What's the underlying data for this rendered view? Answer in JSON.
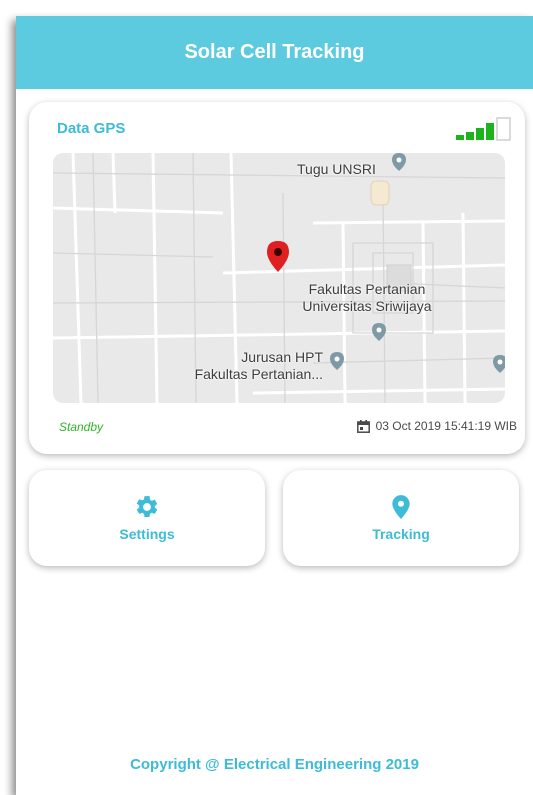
{
  "app": {
    "title": "Solar Cell Tracking"
  },
  "gps_card": {
    "title": "Data GPS",
    "signal_icon": "signal-bars-icon",
    "map_labels": {
      "landmark_1": "Tugu UNSRI",
      "place_line1": "Fakultas Pertanian",
      "place_line2": "Universitas Sriwijaya",
      "dept_line1": "Jurusan HPT",
      "dept_line2": "Fakultas Pertanian..."
    },
    "status": "Standby",
    "datetime": "03 Oct 2019 15:41:19 WIB"
  },
  "actions": {
    "settings": {
      "label": "Settings",
      "icon": "gear-icon"
    },
    "tracking": {
      "label": "Tracking",
      "icon": "location-pin-icon"
    }
  },
  "footer": {
    "text": "Copyright @ Electrical Engineering 2019"
  },
  "colors": {
    "accent": "#5ccbe0",
    "accent_text": "#3cbcd6",
    "status_green": "#2fb52b",
    "signal_green": "#1db31d",
    "marker_red": "#e02020"
  }
}
